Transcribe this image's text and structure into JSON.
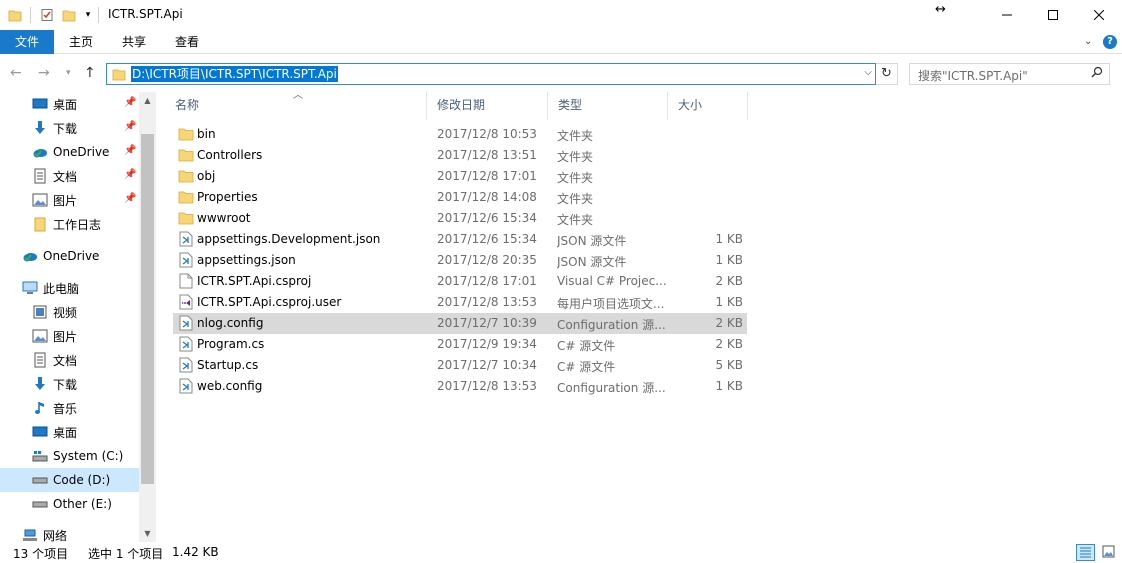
{
  "window": {
    "title": "ICTR.SPT.Api"
  },
  "ribbon": {
    "tabs": [
      "文件",
      "主页",
      "共享",
      "查看"
    ]
  },
  "address": {
    "path": "D:\\ICTR项目\\ICTR.SPT\\ICTR.SPT.Api",
    "search_placeholder": "搜索\"ICTR.SPT.Api\""
  },
  "nav": {
    "quick_access": [
      {
        "label": "桌面",
        "icon": "desktop-icon",
        "pinned": true
      },
      {
        "label": "下载",
        "icon": "download-icon",
        "pinned": true
      },
      {
        "label": "OneDrive",
        "icon": "onedrive-icon",
        "pinned": true
      },
      {
        "label": "文档",
        "icon": "documents-icon",
        "pinned": true
      },
      {
        "label": "图片",
        "icon": "pictures-icon",
        "pinned": true
      },
      {
        "label": "工作日志",
        "icon": "folder-icon",
        "pinned": false
      }
    ],
    "onedrive": "OneDrive",
    "this_pc": "此电脑",
    "pc_items": [
      {
        "label": "视频",
        "icon": "videos-icon"
      },
      {
        "label": "图片",
        "icon": "pictures-icon"
      },
      {
        "label": "文档",
        "icon": "documents-icon"
      },
      {
        "label": "下载",
        "icon": "download-icon"
      },
      {
        "label": "音乐",
        "icon": "music-icon"
      },
      {
        "label": "桌面",
        "icon": "desktop-icon"
      },
      {
        "label": "System (C:)",
        "icon": "system-drive-icon"
      },
      {
        "label": "Code (D:)",
        "icon": "drive-icon"
      },
      {
        "label": "Other (E:)",
        "icon": "drive-icon"
      }
    ],
    "network": "网络"
  },
  "columns": {
    "name": "名称",
    "date": "修改日期",
    "type": "类型",
    "size": "大小"
  },
  "files": [
    {
      "name": "bin",
      "date": "2017/12/8 10:53",
      "type": "文件夹",
      "size": "",
      "icon": "folder-icon"
    },
    {
      "name": "Controllers",
      "date": "2017/12/8 13:51",
      "type": "文件夹",
      "size": "",
      "icon": "folder-icon"
    },
    {
      "name": "obj",
      "date": "2017/12/8 17:01",
      "type": "文件夹",
      "size": "",
      "icon": "folder-icon"
    },
    {
      "name": "Properties",
      "date": "2017/12/8 14:08",
      "type": "文件夹",
      "size": "",
      "icon": "folder-icon"
    },
    {
      "name": "wwwroot",
      "date": "2017/12/6 15:34",
      "type": "文件夹",
      "size": "",
      "icon": "folder-icon"
    },
    {
      "name": "appsettings.Development.json",
      "date": "2017/12/6 15:34",
      "type": "JSON 源文件",
      "size": "1 KB",
      "icon": "vscode-file-icon"
    },
    {
      "name": "appsettings.json",
      "date": "2017/12/8 20:35",
      "type": "JSON 源文件",
      "size": "1 KB",
      "icon": "vscode-file-icon"
    },
    {
      "name": "ICTR.SPT.Api.csproj",
      "date": "2017/12/8 17:01",
      "type": "Visual C# Projec...",
      "size": "2 KB",
      "icon": "blank-file-icon"
    },
    {
      "name": "ICTR.SPT.Api.csproj.user",
      "date": "2017/12/8 13:53",
      "type": "每用户项目选项文...",
      "size": "1 KB",
      "icon": "vs-user-file-icon"
    },
    {
      "name": "nlog.config",
      "date": "2017/12/7 10:39",
      "type": "Configuration 源...",
      "size": "2 KB",
      "icon": "vscode-file-icon",
      "selected": true
    },
    {
      "name": "Program.cs",
      "date": "2017/12/9 19:34",
      "type": "C# 源文件",
      "size": "2 KB",
      "icon": "vscode-file-icon"
    },
    {
      "name": "Startup.cs",
      "date": "2017/12/7 10:34",
      "type": "C# 源文件",
      "size": "5 KB",
      "icon": "vscode-file-icon"
    },
    {
      "name": "web.config",
      "date": "2017/12/8 13:53",
      "type": "Configuration 源...",
      "size": "1 KB",
      "icon": "vscode-file-icon"
    }
  ],
  "status": {
    "count": "13 个项目",
    "selected": "选中 1 个项目",
    "size": "1.42 KB"
  },
  "colors": {
    "accent": "#0078d7",
    "ribbon_file": "#1979ca",
    "selection": "#cce8ff",
    "row_selected": "#d9d9d9",
    "folder": "#e8b13c"
  }
}
